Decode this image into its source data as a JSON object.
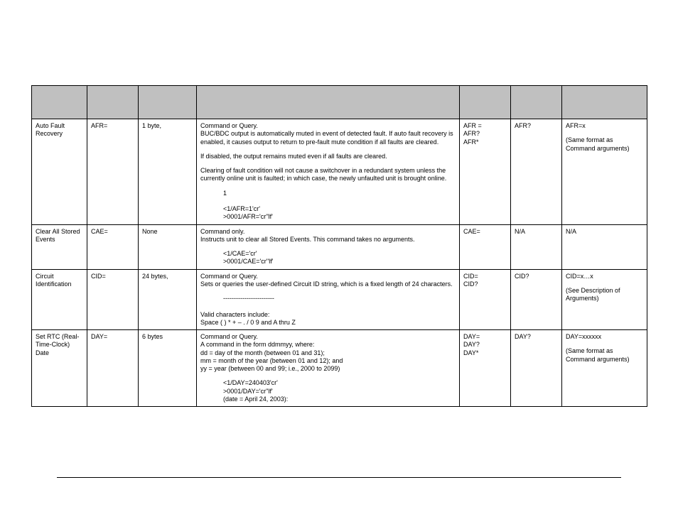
{
  "rows": [
    {
      "parameter": "Auto Fault Recovery",
      "command": "AFR=",
      "arguments": "1 byte,",
      "description": {
        "p1": "Command or Query.",
        "p2": "BUC/BDC output is automatically muted in event of detected fault. If auto fault recovery is enabled, it causes output to return to pre-fault mute condition if all faults are cleared.",
        "p3": "If disabled, the output remains muted even if all faults are cleared.",
        "p4": "Clearing of fault condition will not cause a switchover in a redundant system unless the currently online unit is faulted; in which case, the newly unfaulted unit is brought online.",
        "ex_num": "1",
        "ex1": "<1/AFR=1'cr'",
        "ex2": ">0001/AFR='cr''lf'"
      },
      "response_cmd": "AFR =\nAFR?\nAFR*",
      "query": "AFR?",
      "response_qry": {
        "main": "AFR=x",
        "note": "(Same format as Command arguments)"
      }
    },
    {
      "parameter": "Clear All Stored Events",
      "command": "CAE=",
      "arguments": "None",
      "description": {
        "p1": "Command only.",
        "p2": "Instructs unit to clear all Stored Events. This command takes no arguments.",
        "ex1": "<1/CAE='cr'",
        "ex2": ">0001/CAE='cr''lf'"
      },
      "response_cmd": "CAE=",
      "query": "N/A",
      "response_qry": {
        "main": "N/A"
      }
    },
    {
      "parameter": "Circuit Identification",
      "command": "CID=",
      "arguments": "24 bytes,",
      "description": {
        "p1": "Command or Query.",
        "p2": "Sets or queries the user-defined Circuit ID string, which is a fixed length of 24 characters.",
        "rule": "------------------------",
        "p3": "Valid characters include:",
        "p4": "Space ( ) * + – . / 0 9 and A thru Z"
      },
      "response_cmd": "CID=\nCID?",
      "query": "CID?",
      "response_qry": {
        "main": "CID=x…x",
        "note": "(See Description of Arguments)"
      }
    },
    {
      "parameter": "Set RTC (Real-Time-Clock) Date",
      "command": "DAY=",
      "arguments": "6 bytes",
      "description": {
        "p1": "Command or Query.",
        "p2a": "A command in the form ddmmyy, where:",
        "p2b": "dd = day of the month (between 01 and 31);",
        "p2c": "mm = month of the year (between 01 and 12); and",
        "p2d": "yy = year (between 00 and 99; i.e., 2000 to 2099)",
        "ex1": "<1/DAY=240403'cr'",
        "ex2": ">0001/DAY='cr''lf'",
        "ex3": "(date = April 24, 2003):"
      },
      "response_cmd": "DAY=\nDAY?\nDAY*",
      "query": "DAY?",
      "response_qry": {
        "main": "DAY=xxxxxx",
        "note": "(Same format as Command arguments)"
      }
    }
  ]
}
